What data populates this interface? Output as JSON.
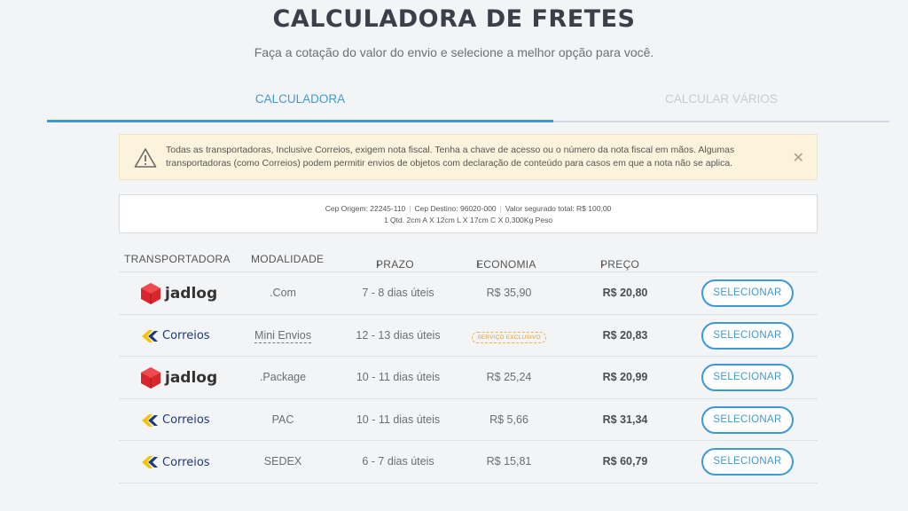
{
  "header": {
    "title": "CALCULADORA DE FRETES",
    "subtitle": "Faça a cotação do valor do envio e selecione a melhor opção para você."
  },
  "tabs": [
    {
      "label": "CALCULADORA",
      "active": true
    },
    {
      "label": "CALCULAR VÁRIOS",
      "active": false
    }
  ],
  "alert": {
    "text": "Todas as transportadoras, Inclusive Correios, exigem nota fiscal. Tenha a chave de acesso ou o número da nota fiscal em mãos. Algumas transportadoras (como Correios) podem permitir envios de objetos com declaração de conteúdo para casos em que a nota não se aplica.",
    "icon": "warning-icon",
    "close_icon": "close-icon"
  },
  "summary": {
    "cep_origem": "Cep Origem: 22245-110",
    "cep_destino": "Cep Destino: 96020-000",
    "valor_segurado": "Valor segurado total: R$ 100,00",
    "pacote": "1 Qtd. 2cm A X 12cm L X 17cm C X 0,300Kg Peso"
  },
  "table": {
    "headers": {
      "transportadora": "TRANSPORTADORA",
      "modalidade": "MODALIDADE",
      "prazo": "PRAZO",
      "economia": "ECONOMIA",
      "preco": "PREÇO"
    },
    "sort_arrow": "↓",
    "rows": [
      {
        "carrier": "jadlog",
        "modalidade": ".Com",
        "prazo": "7 - 8 dias úteis",
        "economia": "R$ 35,90",
        "preco": "R$ 20,80",
        "button": "SELECIONAR"
      },
      {
        "carrier": "Correios",
        "modalidade": "Mini Envios",
        "prazo": "12 - 13 dias úteis",
        "economia_badge": "SERVIÇO EXCLUSIVO",
        "preco": "R$ 20,83",
        "button": "SELECIONAR"
      },
      {
        "carrier": "jadlog",
        "modalidade": ".Package",
        "prazo": "10 - 11 dias úteis",
        "economia": "R$ 25,24",
        "preco": "R$ 20,99",
        "button": "SELECIONAR"
      },
      {
        "carrier": "Correios",
        "modalidade": "PAC",
        "prazo": "10 - 11 dias úteis",
        "economia": "R$ 5,66",
        "preco": "R$ 31,34",
        "button": "SELECIONAR"
      },
      {
        "carrier": "Correios",
        "modalidade": "SEDEX",
        "prazo": "6 - 7 dias úteis",
        "economia": "R$ 15,81",
        "preco": "R$ 60,79",
        "button": "SELECIONAR"
      }
    ]
  },
  "colors": {
    "accent": "#3d9ad8",
    "sort_accent": "#e03c3c",
    "alert_bg": "#fcf3dd",
    "jadlog_red": "#d9262c",
    "correios_yellow": "#f5c400",
    "correios_blue": "#1d3a7a"
  }
}
